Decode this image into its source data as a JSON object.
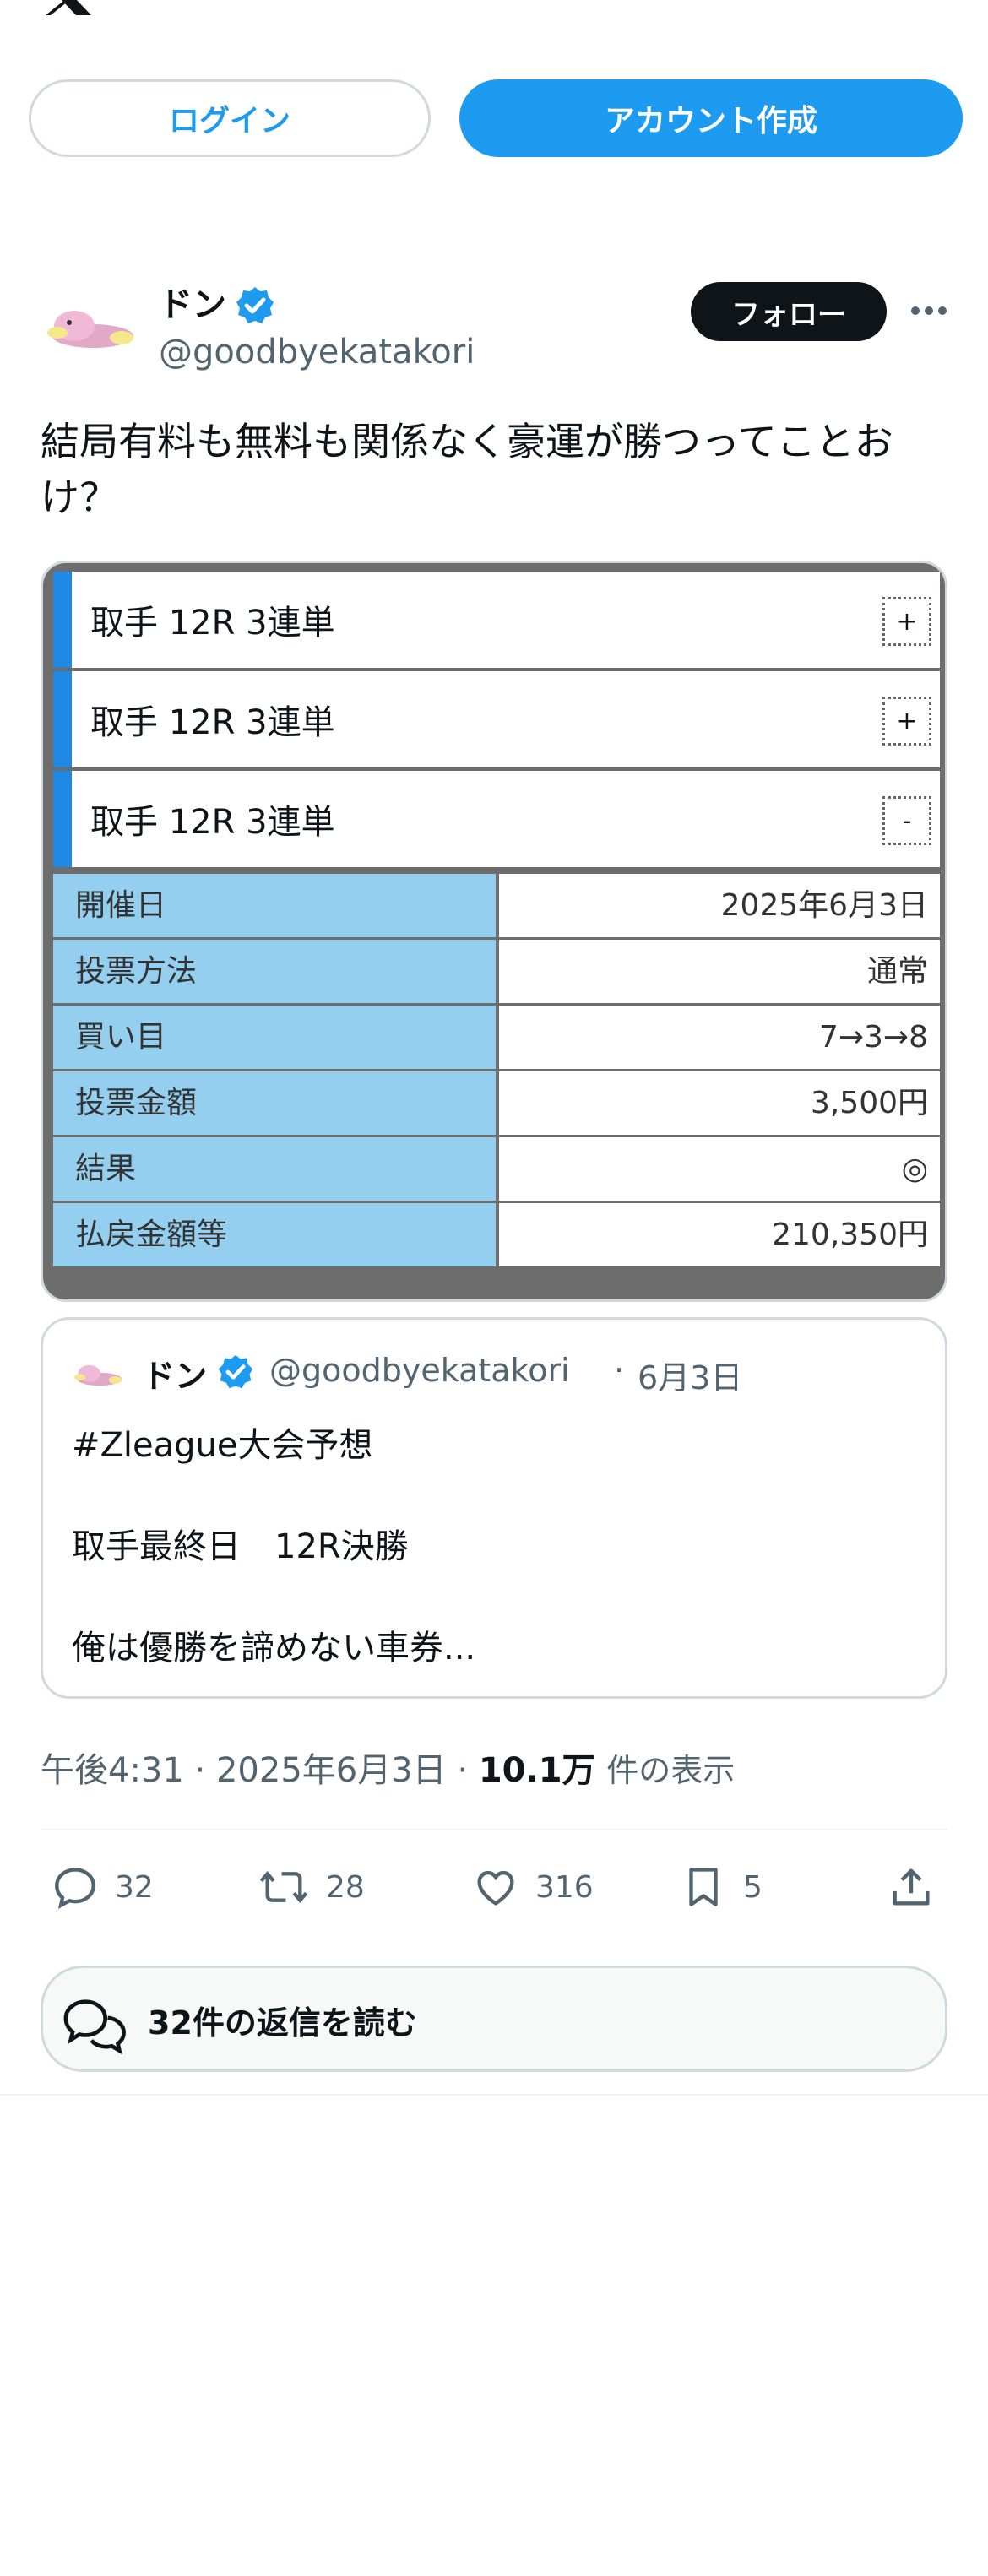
{
  "header": {
    "logo_icon": "x-logo-icon",
    "login_label": "ログイン",
    "signup_label": "アカウント作成"
  },
  "tweet": {
    "author_name": "ドン",
    "author_handle": "@goodbyekatakori",
    "verified": true,
    "follow_label": "フォロー",
    "more_icon": "more-icon",
    "text": "結局有料も無料も関係なく豪運が勝つってことおけ？",
    "time": "午後4:31",
    "date": "2025年6月3日",
    "views_count": "10.1万",
    "views_label": "件の表示"
  },
  "card": {
    "races": [
      {
        "label": "取手  12R  3連単",
        "toggle": "+"
      },
      {
        "label": "取手  12R  3連単",
        "toggle": "+"
      },
      {
        "label": "取手  12R  3連単",
        "toggle": "-"
      }
    ],
    "details": [
      {
        "key": "開催日",
        "value": "2025年6月3日"
      },
      {
        "key": "投票方法",
        "value": "通常"
      },
      {
        "key": "買い目",
        "value": "7→3→8"
      },
      {
        "key": "投票金額",
        "value": "3,500円"
      },
      {
        "key": "結果",
        "value": "◎"
      },
      {
        "key": "払戻金額等",
        "value": "210,350円"
      }
    ]
  },
  "quote": {
    "author_name": "ドン",
    "author_handle": "@goodbyekatakori",
    "date": "6月3日",
    "line1": "#Zleague大会予想",
    "line2": "取手最終日　12R決勝",
    "line3": "俺は優勝を諦めない車券..."
  },
  "actions": {
    "replies": "32",
    "reposts": "28",
    "likes": "316",
    "bookmarks": "5"
  },
  "read_replies_label": "32件の返信を読む",
  "colors": {
    "accent": "#1d9bf0",
    "card_blue_bar": "#1e88e5",
    "table_key_bg": "#95cff0"
  }
}
